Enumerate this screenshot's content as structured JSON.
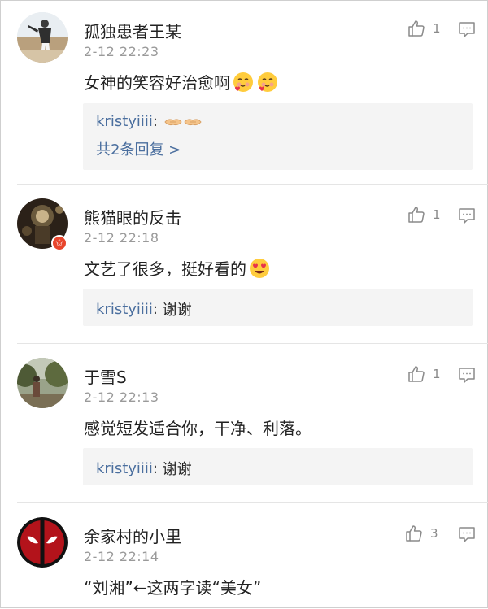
{
  "comments": [
    {
      "username": "孤独患者王某",
      "time": "2-12 22:23",
      "likes": "1",
      "content": "女神的笑容好治愈啊",
      "content_emoji": [
        "blushing-heart-emoji",
        "blushing-heart-emoji"
      ],
      "replies": [
        {
          "user": "kristyiiii",
          "sep": ": ",
          "text": "",
          "emoji": [
            "handshake-emoji",
            "handshake-emoji"
          ]
        }
      ],
      "more_replies": "共2条回复 >"
    },
    {
      "username": "熊猫眼的反击",
      "time": "2-12 22:18",
      "likes": "1",
      "content": "文艺了很多，挺好看的",
      "content_emoji": [
        "heart-eyes-emoji"
      ],
      "verified_badge": true,
      "replies": [
        {
          "user": "kristyiiii",
          "sep": ": ",
          "text": "谢谢"
        }
      ]
    },
    {
      "username": "于雪S",
      "time": "2-12 22:13",
      "likes": "1",
      "content": "感觉短发适合你，干净、利落。",
      "replies": [
        {
          "user": "kristyiiii",
          "sep": ": ",
          "text": "谢谢"
        }
      ]
    },
    {
      "username": "余家村的小里",
      "time": "2-12 22:14",
      "likes": "3",
      "content": "“刘湘”←这两字读“美女”"
    }
  ],
  "icons": {
    "like": "thumbs-up-icon",
    "reply": "comment-bubble-icon"
  },
  "colors": {
    "link_blue": "#4a6e9e",
    "time_gray": "#9a9a9a",
    "reply_bg": "#f4f4f4",
    "badge_red": "#e8452c"
  }
}
